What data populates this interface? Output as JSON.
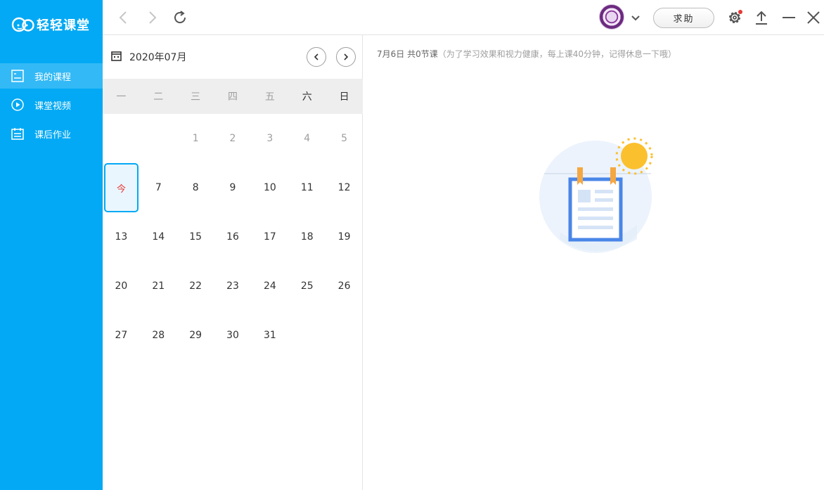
{
  "app": {
    "name": "轻轻课堂"
  },
  "sidebar": {
    "items": [
      {
        "label": "我的课程",
        "icon": "course-list-icon",
        "active": true
      },
      {
        "label": "课堂视频",
        "icon": "play-circle-icon",
        "active": false
      },
      {
        "label": "课后作业",
        "icon": "homework-icon",
        "active": false
      }
    ]
  },
  "topbar": {
    "help_label": "求助",
    "icons": [
      "back-arrow-icon",
      "forward-arrow-icon",
      "refresh-icon",
      "avatar",
      "chevron-down-icon",
      "settings-icon",
      "upload-icon",
      "minimize-icon",
      "close-icon"
    ]
  },
  "calendar": {
    "month_label": "2020年07月",
    "weekdays": [
      "一",
      "二",
      "三",
      "四",
      "五",
      "六",
      "日"
    ],
    "today_label": "今",
    "weeks": [
      [
        "",
        "",
        "1",
        "2",
        "3",
        "4",
        "5"
      ],
      [
        "今",
        "7",
        "8",
        "9",
        "10",
        "11",
        "12"
      ],
      [
        "13",
        "14",
        "15",
        "16",
        "17",
        "18",
        "19"
      ],
      [
        "20",
        "21",
        "22",
        "23",
        "24",
        "25",
        "26"
      ],
      [
        "27",
        "28",
        "29",
        "30",
        "31",
        "",
        ""
      ]
    ]
  },
  "main": {
    "summary_date": "7月6日 共0节课",
    "summary_hint": "（为了学习效果和视力健康，每上课40分钟，记得休息一下哦）"
  },
  "colors": {
    "accent": "#03a9f4",
    "today_text": "#e53935",
    "sun": "#fbc02d",
    "clip": "#f5a742",
    "paper": "#4a86e8"
  }
}
